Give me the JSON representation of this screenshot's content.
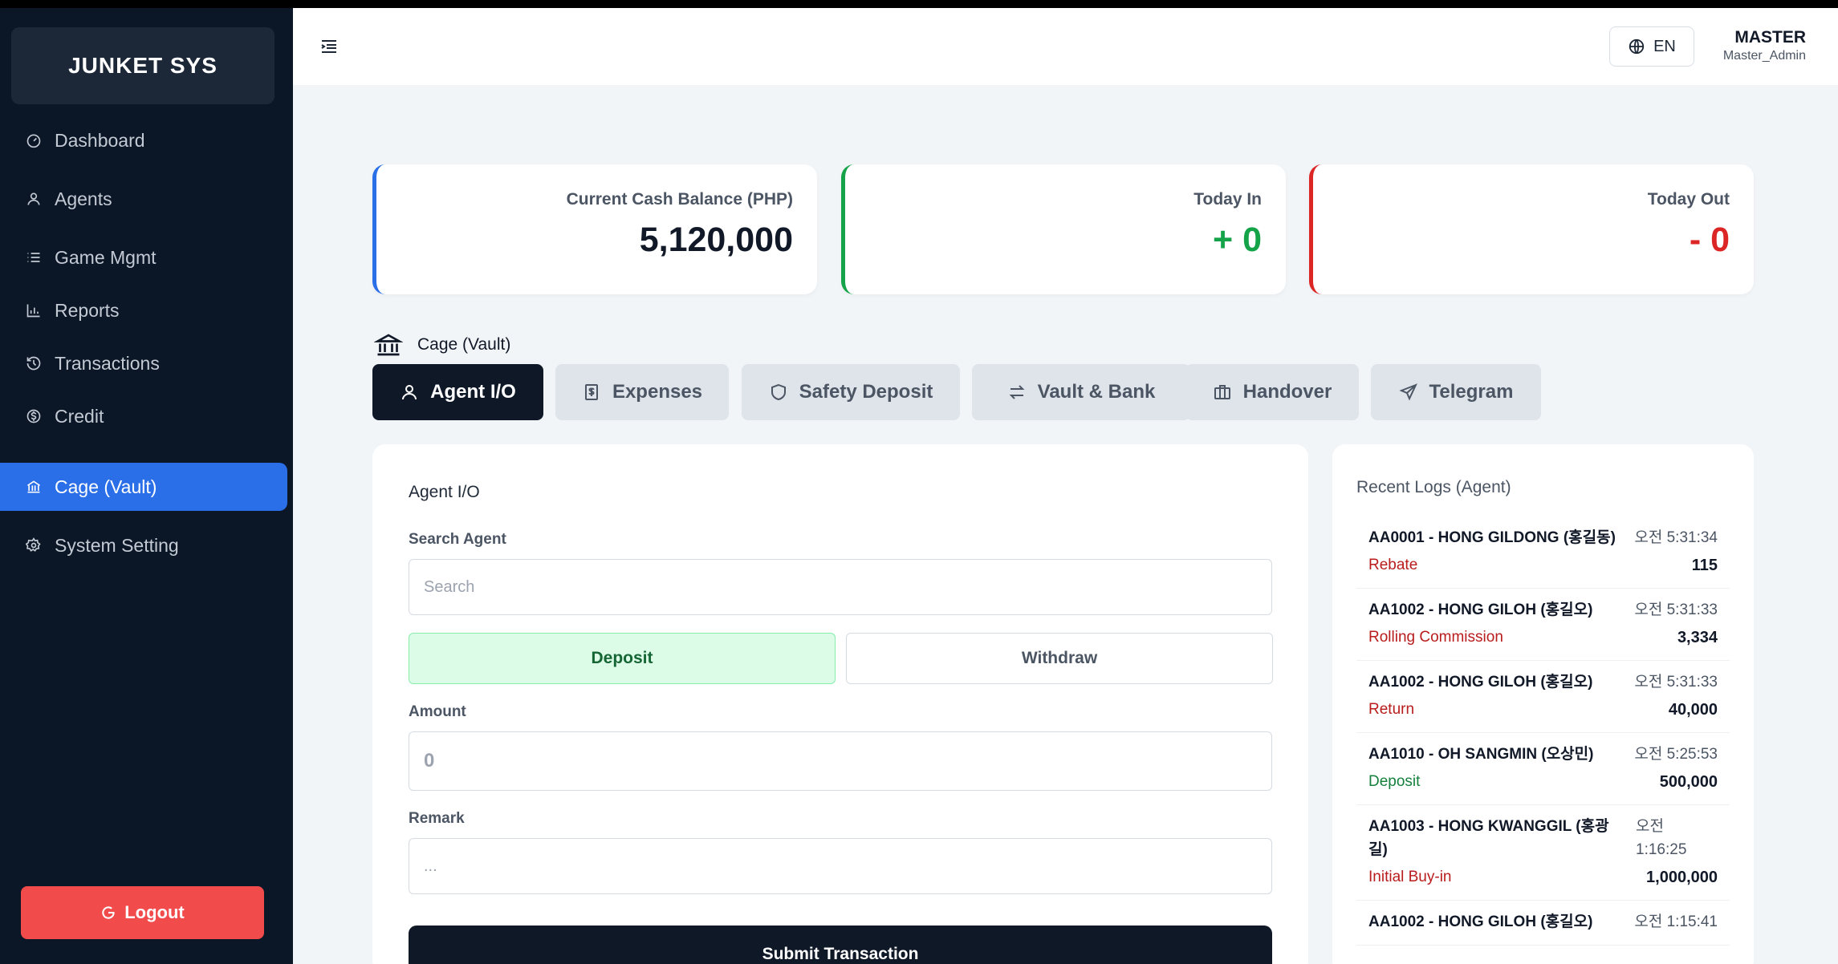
{
  "brand": "JUNKET SYS",
  "sidebar": {
    "items": [
      {
        "label": "Dashboard",
        "icon": "dashboard-icon"
      },
      {
        "label": "Agents",
        "icon": "user-icon"
      },
      {
        "label": "Game Mgmt",
        "icon": "list-icon"
      },
      {
        "label": "Reports",
        "icon": "bar-chart-icon"
      },
      {
        "label": "Transactions",
        "icon": "history-icon"
      },
      {
        "label": "Credit",
        "icon": "dollar-icon"
      },
      {
        "label": "Cage (Vault)",
        "icon": "bank-icon",
        "active": true
      },
      {
        "label": "System Setting",
        "icon": "gear-icon"
      }
    ],
    "logout_label": "Logout"
  },
  "topbar": {
    "lang": "EN",
    "user_name": "MASTER",
    "user_role": "Master_Admin"
  },
  "stats": {
    "balance": {
      "label": "Current Cash Balance (PHP)",
      "value": "5,120,000"
    },
    "today_in": {
      "label": "Today In",
      "value": "+ 0"
    },
    "today_out": {
      "label": "Today Out",
      "value": "- 0"
    }
  },
  "section": {
    "title": "Cage (Vault)"
  },
  "tabs": [
    {
      "label": "Agent I/O",
      "active": true
    },
    {
      "label": "Expenses"
    },
    {
      "label": "Safety Deposit"
    },
    {
      "label": "Vault & Bank"
    },
    {
      "label": "Handover"
    },
    {
      "label": "Telegram"
    }
  ],
  "form": {
    "title": "Agent I/O",
    "search_label": "Search Agent",
    "search_placeholder": "Search",
    "deposit_label": "Deposit",
    "withdraw_label": "Withdraw",
    "amount_label": "Amount",
    "amount_placeholder": "0",
    "remark_label": "Remark",
    "remark_placeholder": "...",
    "submit_label": "Submit Transaction"
  },
  "logs": {
    "title": "Recent Logs (Agent)",
    "items": [
      {
        "agent": "AA0001 - HONG GILDONG (홍길동)",
        "time": "오전 5:31:34",
        "type": "Rebate",
        "type_color": "red",
        "amount": "115"
      },
      {
        "agent": "AA1002 - HONG GILOH (홍길오)",
        "time": "오전 5:31:33",
        "type": "Rolling Commission",
        "type_color": "red",
        "amount": "3,334"
      },
      {
        "agent": "AA1002 - HONG GILOH (홍길오)",
        "time": "오전 5:31:33",
        "type": "Return",
        "type_color": "red",
        "amount": "40,000"
      },
      {
        "agent": "AA1010 - OH SANGMIN (오상민)",
        "time": "오전 5:25:53",
        "type": "Deposit",
        "type_color": "green",
        "amount": "500,000"
      },
      {
        "agent": "AA1003 - HONG KWANGGIL (홍광길)",
        "time": "오전 1:16:25",
        "type": "Initial Buy-in",
        "type_color": "red",
        "amount": "1,000,000"
      },
      {
        "agent": "AA1002 - HONG GILOH (홍길오)",
        "time": "오전 1:15:41",
        "type": "",
        "type_color": "red",
        "amount": ""
      }
    ]
  },
  "colors": {
    "sidebar_bg": "#0b1627",
    "accent_blue": "#2a6ee8",
    "positive_green": "#15a34a",
    "negative_red": "#dc2626",
    "logout_red": "#f14b4b"
  }
}
